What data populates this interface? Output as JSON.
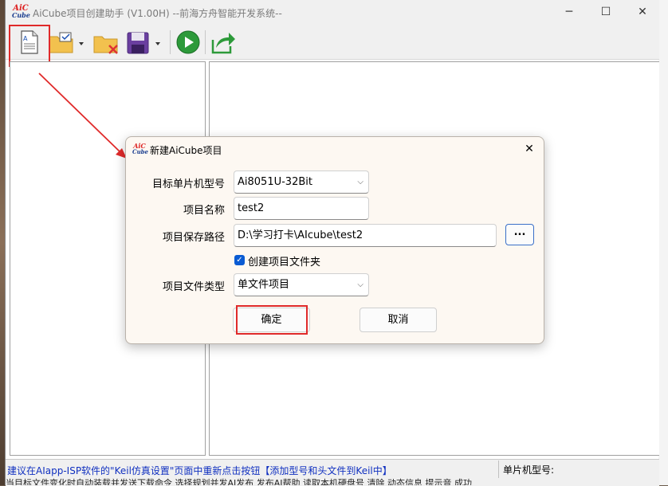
{
  "window": {
    "title": "AiCube项目创建助手 (V1.00H)  --前海方舟智能开发系统--",
    "logo_top": "AiC",
    "logo_bottom": "Cube",
    "minimize": "─",
    "maximize": "☐",
    "close": "✕"
  },
  "toolbar": {
    "icons": [
      "new-file-icon",
      "open-folder-icon",
      "close-folder-icon",
      "save-icon",
      "run-icon",
      "export-icon"
    ]
  },
  "status": {
    "hint": "建议在AIapp-ISP软件的\"Keil仿真设置\"页面中重新点击按钮【添加型号和头文件到Keil中】",
    "mcu_label": "单片机型号:",
    "bottom_fragments": "当目标文件变化时自动装载并发送下载命令          选择规划并发AI发布  发布AI帮助  读取本机硬盘号   清除   动态信息    提示音  成功"
  },
  "dialog": {
    "title": "新建AiCube项目",
    "close": "✕",
    "mcu_model_label": "目标单片机型号",
    "mcu_model_value": "Ai8051U-32Bit",
    "project_name_label": "项目名称",
    "project_name_value": "test2",
    "save_path_label": "项目保存路径",
    "save_path_value": "D:\\学习打卡\\AIcube\\test2",
    "browse_label": "...",
    "create_folder_label": "创建项目文件夹",
    "create_folder_checked": true,
    "file_type_label": "项目文件类型",
    "file_type_value": "单文件项目",
    "ok_label": "确定",
    "cancel_label": "取消"
  },
  "colors": {
    "highlight": "#e02a2a",
    "checkbox": "#0a5bd3",
    "hint_text": "#1030c0"
  }
}
